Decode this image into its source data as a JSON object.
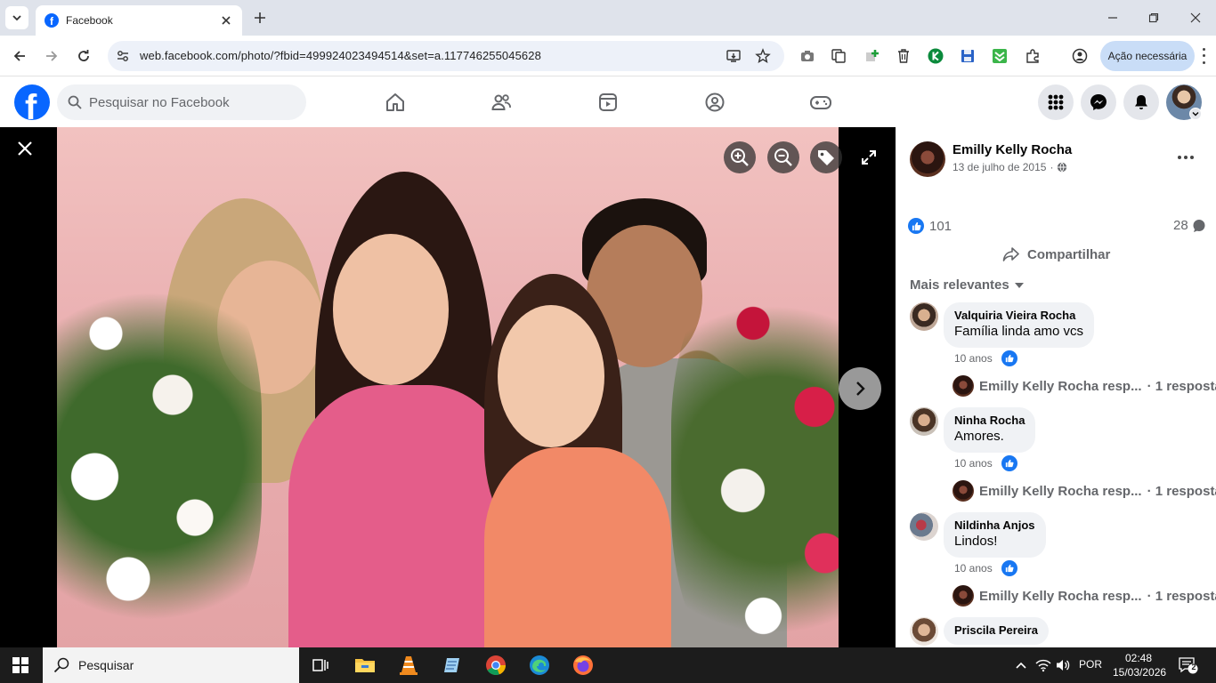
{
  "browser": {
    "tab_title": "Facebook",
    "url": "web.facebook.com/photo/?fbid=499924023494514&set=a.117746255045628",
    "action_label": "Ação necessária"
  },
  "facebook": {
    "logo": "f",
    "search_placeholder": "Pesquisar no Facebook"
  },
  "post": {
    "author": "Emilly Kelly Rocha",
    "date": "13 de julho de 2015",
    "date_separator": "·",
    "reactions_count": "101",
    "comments_count": "28",
    "share_label": "Compartilhar",
    "sort_label": "Mais relevantes"
  },
  "comments": [
    {
      "name": "Valquiria Vieira Rocha",
      "text": "Família linda amo vcs",
      "time": "10 anos",
      "reply_author": "Emilly Kelly Rocha resp...",
      "reply_count": "· 1 resposta"
    },
    {
      "name": "Ninha Rocha",
      "text": "Amores.",
      "time": "10 anos",
      "reply_author": "Emilly Kelly Rocha resp...",
      "reply_count": "· 1 resposta"
    },
    {
      "name": "Nildinha Anjos",
      "text": "Lindos!",
      "time": "10 anos",
      "reply_author": "Emilly Kelly Rocha resp...",
      "reply_count": "· 1 resposta"
    },
    {
      "name": "Priscila Pereira"
    }
  ],
  "taskbar": {
    "search_label": "Pesquisar",
    "language": "POR",
    "time": "02:48",
    "date": "15/03/2026",
    "notification_count": "2"
  },
  "colors": {
    "fb_blue": "#0866ff",
    "like_blue": "#1877f2",
    "chrome_tabbar": "#dfe3eb",
    "omnibox": "#edf1f9",
    "taskbar": "#1c1c1c"
  }
}
